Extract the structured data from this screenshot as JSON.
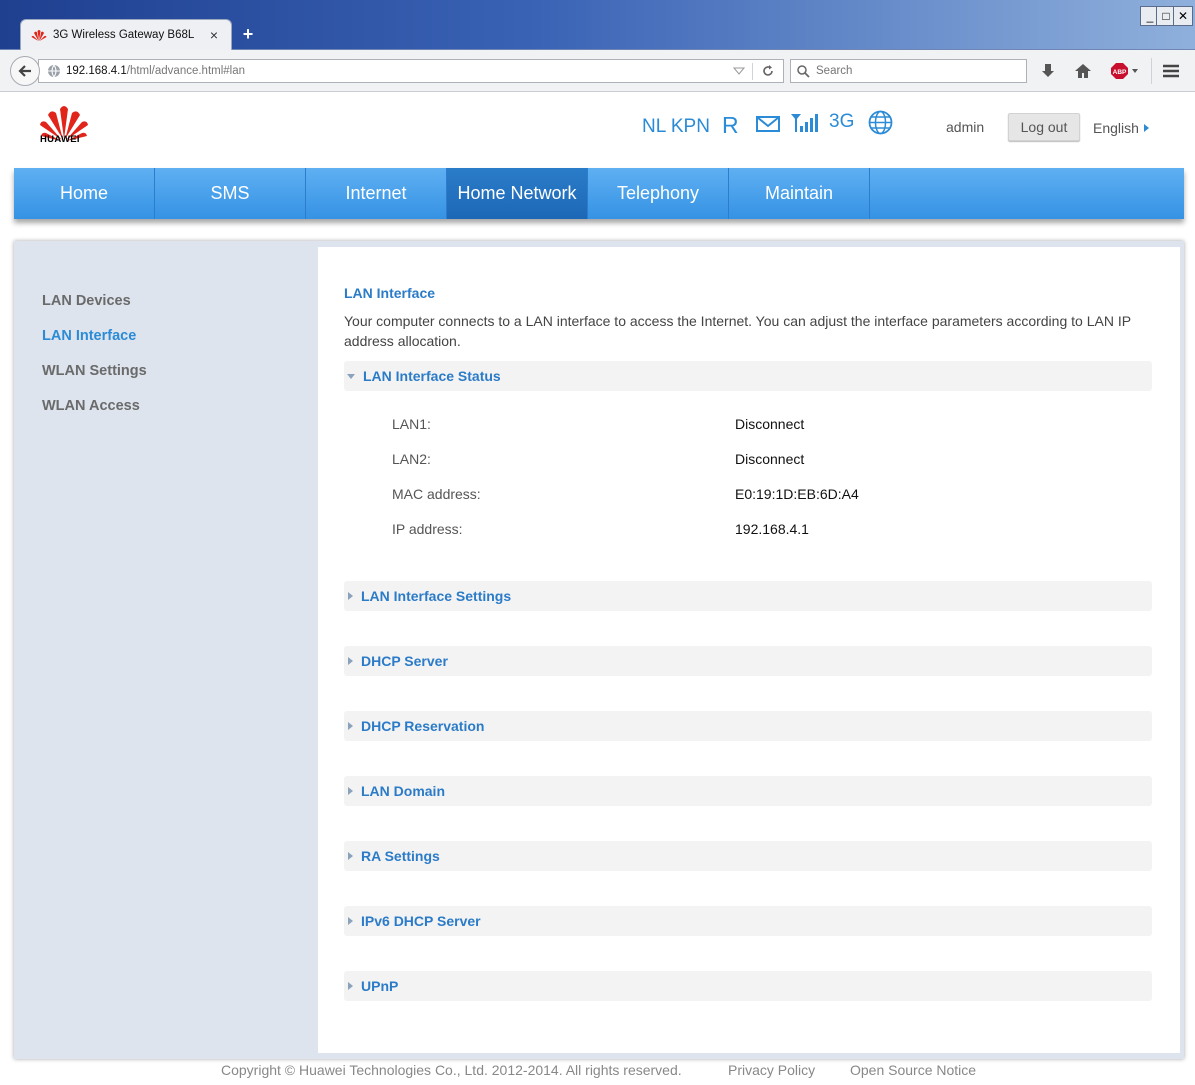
{
  "browser": {
    "tab_title": "3G Wireless Gateway B68L",
    "tab_close": "×",
    "new_tab": "+",
    "url_host": "192.168.4.1",
    "url_path": "/html/advance.html#lan",
    "search_placeholder": "Search",
    "window_controls": {
      "minimize": "_",
      "maximize": "□",
      "close": "✕"
    }
  },
  "header": {
    "logo_text": "HUAWEI",
    "carrier": "NL KPN",
    "roaming": "R",
    "network_type": "3G",
    "user": "admin",
    "logout_label": "Log out",
    "language": "English"
  },
  "main_nav": [
    {
      "label": "Home",
      "active": false
    },
    {
      "label": "SMS",
      "active": false
    },
    {
      "label": "Internet",
      "active": false
    },
    {
      "label": "Home Network",
      "active": true
    },
    {
      "label": "Telephony",
      "active": false
    },
    {
      "label": "Maintain",
      "active": false
    }
  ],
  "sidebar": {
    "items": [
      {
        "label": "LAN Devices",
        "active": false
      },
      {
        "label": "LAN Interface",
        "active": true
      },
      {
        "label": "WLAN Settings",
        "active": false
      },
      {
        "label": "WLAN Access",
        "active": false
      }
    ]
  },
  "content": {
    "title": "LAN Interface",
    "description": "Your computer connects to a LAN interface to access the Internet. You can adjust the interface parameters according to LAN IP address allocation.",
    "status_section": {
      "label": "LAN Interface Status",
      "expanded": true,
      "rows": [
        {
          "key": "LAN1:",
          "value": "Disconnect"
        },
        {
          "key": "LAN2:",
          "value": "Disconnect"
        },
        {
          "key": "MAC address:",
          "value": "E0:19:1D:EB:6D:A4"
        },
        {
          "key": "IP address:",
          "value": "192.168.4.1"
        }
      ]
    },
    "sections": [
      {
        "label": "LAN Interface Settings"
      },
      {
        "label": "DHCP Server"
      },
      {
        "label": "DHCP Reservation"
      },
      {
        "label": "LAN Domain"
      },
      {
        "label": "RA Settings"
      },
      {
        "label": "IPv6 DHCP Server"
      },
      {
        "label": "UPnP"
      }
    ]
  },
  "footer": {
    "copyright": "Copyright © Huawei Technologies Co., Ltd. 2012-2014. All rights reserved.",
    "privacy": "Privacy Policy",
    "open_source": "Open Source Notice"
  },
  "colors": {
    "accent": "#2b8bd6",
    "nav_blue": "#3592e4",
    "nav_active": "#1d68b6",
    "sidebar_bg": "#dde4ee",
    "huawei_red": "#e1251b"
  },
  "icons": {
    "favicon": "huawei-logo-icon",
    "back": "back-arrow-icon",
    "site": "globe-icon",
    "reload": "reload-icon",
    "search": "search-icon",
    "download": "download-icon",
    "home": "home-icon",
    "adblock": "adblock-plus-icon",
    "menu": "hamburger-menu-icon",
    "mail": "mail-icon",
    "signal": "signal-strength-icon",
    "globe": "internet-globe-icon"
  }
}
